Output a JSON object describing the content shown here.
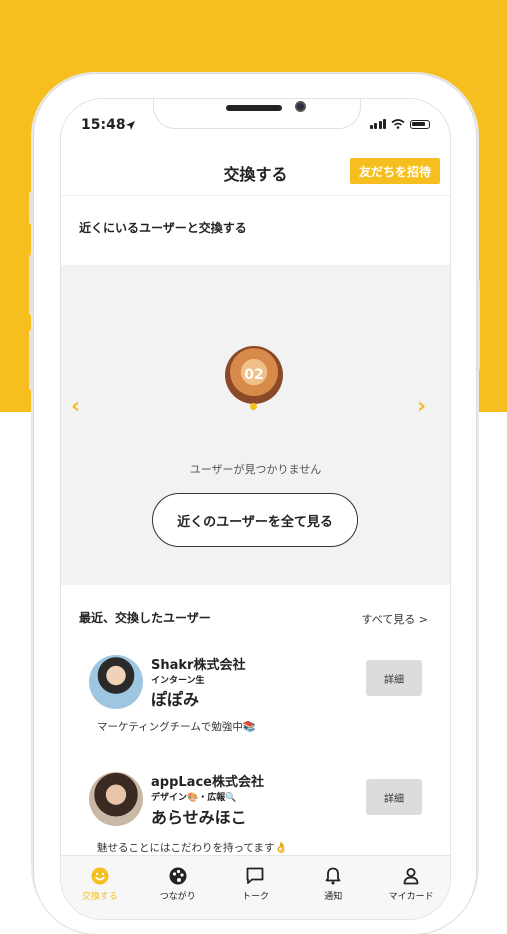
{
  "status": {
    "time": "15:48"
  },
  "header": {
    "title": "交換する",
    "invite_label": "友だちを招待"
  },
  "nearby": {
    "title": "近くにいるユーザーと交換する",
    "avatar_text": "02",
    "empty_text": "ユーザーが見つかりません",
    "see_all_label": "近くのユーザーを全て見る"
  },
  "recent": {
    "title": "最近、交換したユーザー",
    "see_all_label": "すべて見る >",
    "users": [
      {
        "company": "Shakr株式会社",
        "role": "インターン生",
        "name": "ぽぽみ",
        "message": "マーケティングチームで勉強中📚",
        "detail_label": "詳細"
      },
      {
        "company": "appLace株式会社",
        "role": "デザイン🎨・広報🔍",
        "name": "あらせみほこ",
        "message": "魅せることにはこだわりを持ってます👌",
        "detail_label": "詳細"
      }
    ]
  },
  "tabs": [
    {
      "label": "交換する",
      "icon": "smile-icon",
      "active": true
    },
    {
      "label": "つながり",
      "icon": "palette-icon",
      "active": false
    },
    {
      "label": "トーク",
      "icon": "chat-icon",
      "active": false
    },
    {
      "label": "通知",
      "icon": "bell-icon",
      "active": false
    },
    {
      "label": "マイカード",
      "icon": "person-icon",
      "active": false
    }
  ],
  "colors": {
    "accent": "#f6be1e",
    "panel": "#f2f2f2"
  }
}
